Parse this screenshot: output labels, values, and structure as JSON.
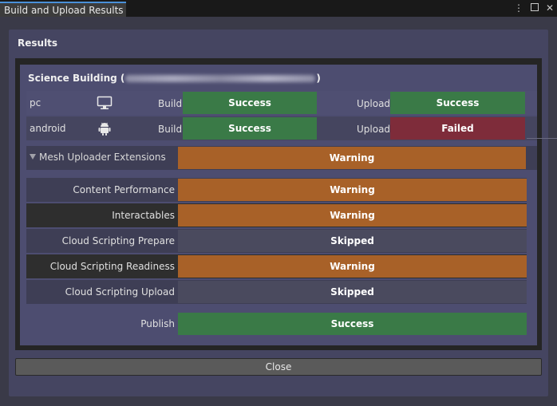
{
  "window": {
    "tab_title": "Build and Upload Results",
    "menu_icon": "kebab-menu-icon",
    "maximize_icon": "maximize-icon",
    "close_icon": "close-icon"
  },
  "results_label": "Results",
  "building": {
    "title_prefix": "Science Building (",
    "title_suffix": ")"
  },
  "platforms": [
    {
      "name": "pc",
      "icon": "monitor-icon",
      "build_label": "Build",
      "build_status": "Success",
      "upload_label": "Upload",
      "upload_status": "Success"
    },
    {
      "name": "android",
      "icon": "android-icon",
      "build_label": "Build",
      "build_status": "Success",
      "upload_label": "Upload",
      "upload_status": "Failed"
    }
  ],
  "extensions": {
    "label": "Mesh Uploader Extensions",
    "status": "Warning"
  },
  "checks": [
    {
      "label": "Content Performance",
      "status": "Warning"
    },
    {
      "label": "Interactables",
      "status": "Warning"
    },
    {
      "label": "Cloud Scripting Prepare",
      "status": "Skipped"
    },
    {
      "label": "Cloud Scripting Readiness",
      "status": "Warning"
    },
    {
      "label": "Cloud Scripting Upload",
      "status": "Skipped"
    }
  ],
  "publish": {
    "label": "Publish",
    "status": "Success"
  },
  "close_label": "Close",
  "colors": {
    "success": "#3a7a47",
    "failed": "#7e2c3a",
    "warning": "#a86128",
    "skipped": "#4a4a5e"
  }
}
